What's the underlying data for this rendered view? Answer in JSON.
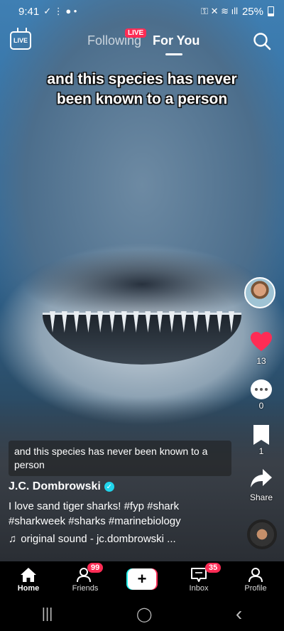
{
  "status_bar": {
    "time": "9:41",
    "battery": "25%"
  },
  "top_nav": {
    "live_label": "LIVE",
    "live_badge": "LIVE",
    "tab_following": "Following",
    "tab_for_you": "For You"
  },
  "video": {
    "caption": "and this species has never been known to a person"
  },
  "actions": {
    "like_count": "13",
    "comment_count": "0",
    "save_count": "1",
    "share_label": "Share",
    "like_color": "#fe2c55"
  },
  "post": {
    "subtitle": "and this species has never been known to a person",
    "username": "J.C. Dombrowski",
    "description_line1": "I love sand tiger sharks! #fyp #shark",
    "description_line2": "#sharkweek #sharks #marinebiology",
    "sound": "original sound - jc.dombrowski ..."
  },
  "bottom_nav": {
    "home": "Home",
    "friends": "Friends",
    "friends_badge": "99",
    "create": "+",
    "inbox": "Inbox",
    "inbox_badge": "35",
    "profile": "Profile"
  },
  "android_nav": {
    "recents": "|||",
    "home": "◯",
    "back": "‹"
  }
}
